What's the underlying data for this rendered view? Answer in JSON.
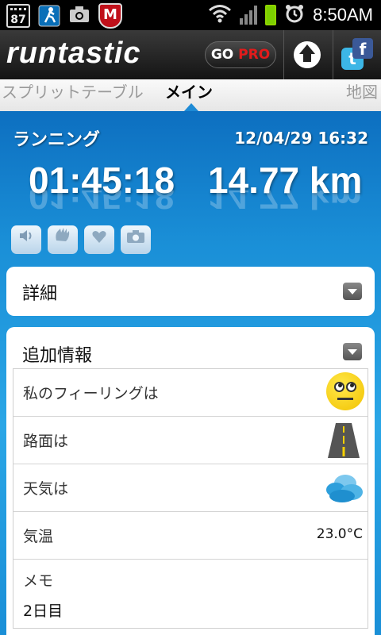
{
  "status_bar": {
    "calendar_day": "87",
    "time": "8:50AM",
    "mcafee_letter": "M",
    "icons": [
      "calendar-icon",
      "runner-notification-icon",
      "camera-icon",
      "mcafee-icon",
      "wifi-icon",
      "signal-icon",
      "battery-icon",
      "alarm-icon"
    ]
  },
  "header": {
    "logo": "runtastic",
    "gopro_go": "GO",
    "gopro_pro": "PRO"
  },
  "tabs": {
    "split": "スプリットテーブル",
    "main": "メイン",
    "map": "地図"
  },
  "session": {
    "activity": "ランニング",
    "datetime": "12/04/29 16:32",
    "duration": "01:45:18",
    "distance": "14.77 km"
  },
  "details": {
    "title": "詳細"
  },
  "extra": {
    "title": "追加情報",
    "feeling_label": "私のフィーリングは",
    "surface_label": "路面は",
    "weather_label": "天気は",
    "temp_label": "気温",
    "temp_value": "23.0°C",
    "memo_label": "メモ",
    "memo_value": "2日目"
  },
  "colors": {
    "accent_blue": "#1a8fd7",
    "header_dark": "#1f1f1f",
    "pro_red": "#e21b1b",
    "smiley_yellow": "#f2c200"
  }
}
